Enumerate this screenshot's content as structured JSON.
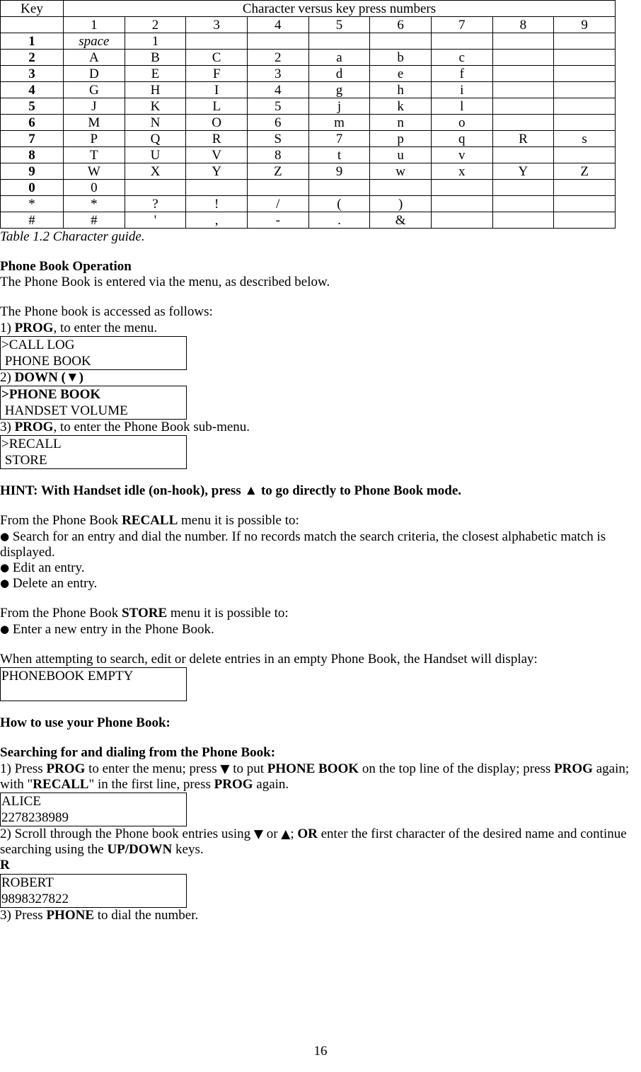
{
  "table": {
    "caption": "Table 1.2 Character guide.",
    "key_header": "Key",
    "span_header": "Character versus key press numbers",
    "press_columns": [
      "1",
      "2",
      "3",
      "4",
      "5",
      "6",
      "7",
      "8",
      "9"
    ],
    "rows": [
      {
        "key": "1",
        "key_bold": true,
        "cells": [
          "space",
          "1",
          "",
          "",
          "",
          "",
          "",
          "",
          ""
        ],
        "italic_first": true
      },
      {
        "key": "2",
        "key_bold": true,
        "cells": [
          "A",
          "B",
          "C",
          "2",
          "a",
          "b",
          "c",
          "",
          ""
        ],
        "italic_first": false
      },
      {
        "key": "3",
        "key_bold": true,
        "cells": [
          "D",
          "E",
          "F",
          "3",
          "d",
          "e",
          "f",
          "",
          ""
        ],
        "italic_first": false
      },
      {
        "key": "4",
        "key_bold": true,
        "cells": [
          "G",
          "H",
          "I",
          "4",
          "g",
          "h",
          "i",
          "",
          ""
        ],
        "italic_first": false
      },
      {
        "key": "5",
        "key_bold": true,
        "cells": [
          "J",
          "K",
          "L",
          "5",
          "j",
          "k",
          "l",
          "",
          ""
        ],
        "italic_first": false
      },
      {
        "key": "6",
        "key_bold": true,
        "cells": [
          "M",
          "N",
          "O",
          "6",
          "m",
          "n",
          "o",
          "",
          ""
        ],
        "italic_first": false
      },
      {
        "key": "7",
        "key_bold": true,
        "cells": [
          "P",
          "Q",
          "R",
          "S",
          "7",
          "p",
          "q",
          "R",
          "s"
        ],
        "italic_first": false
      },
      {
        "key": "8",
        "key_bold": true,
        "cells": [
          "T",
          "U",
          "V",
          "8",
          "t",
          "u",
          "v",
          "",
          ""
        ],
        "italic_first": false
      },
      {
        "key": "9",
        "key_bold": true,
        "cells": [
          "W",
          "X",
          "Y",
          "Z",
          "9",
          "w",
          "x",
          "Y",
          "Z"
        ],
        "italic_first": false
      },
      {
        "key": "0",
        "key_bold": true,
        "cells": [
          "0",
          "",
          "",
          "",
          "",
          "",
          "",
          "",
          ""
        ],
        "italic_first": false
      },
      {
        "key": "*",
        "key_bold": false,
        "cells": [
          "*",
          "?",
          "!",
          "/",
          "(",
          ")",
          "",
          "",
          ""
        ],
        "italic_first": false
      },
      {
        "key": "#",
        "key_bold": false,
        "cells": [
          "#",
          "'",
          ",",
          "-",
          ".",
          "&",
          "",
          "",
          ""
        ],
        "italic_first": false
      }
    ]
  },
  "sections": {
    "phone_book_operation": {
      "heading": "Phone Book Operation",
      "intro": "The Phone Book is entered via the menu, as described below.",
      "accessed_as_follows": "The Phone book is accessed as follows:",
      "step1_prefix": "1) ",
      "step1_bold": "PROG",
      "step1_suffix": ", to enter the menu.",
      "lcd1_line1": ">CALL LOG",
      "lcd1_line2": " PHONE BOOK",
      "step2_prefix": "2)  ",
      "step2_bold": "DOWN (▼)",
      "lcd2_line1": ">PHONE BOOK",
      "lcd2_line2": " HANDSET VOLUME",
      "step3_prefix": "3) ",
      "step3_bold": "PROG",
      "step3_suffix": ", to enter the Phone Book sub-menu.",
      "lcd3_line1": ">RECALL",
      "lcd3_line2": " STORE"
    },
    "hint": "HINT: With Handset idle (on-hook), press ▲ to go directly to Phone Book mode.",
    "recall": {
      "lead_prefix": "From the Phone Book ",
      "lead_bold": "RECALL",
      "lead_suffix": " menu it is possible to:",
      "bullets": [
        "Search for an entry and dial the number. If no records match the search criteria, the closest alphabetic match is displayed.",
        "Edit an entry.",
        "Delete an entry."
      ]
    },
    "store": {
      "lead_prefix": "From the Phone Book ",
      "lead_bold": "STORE",
      "lead_suffix": " menu it is possible to:",
      "bullets": [
        "Enter a new entry in the Phone Book."
      ]
    },
    "empty_book": {
      "text": "When attempting to search, edit or delete entries in an empty Phone Book, the Handset will display:",
      "lcd_line1": "PHONEBOOK EMPTY",
      "lcd_line2": ""
    },
    "how_to_use": {
      "heading": "How to use your Phone Book:",
      "sub_heading": "Searching for and dialing from the Phone Book:",
      "step1_p1": "1) Press ",
      "step1_b1": "PROG",
      "step1_p2": " to enter the menu; press ",
      "step1_b2": "▼",
      "step1_p3": " to put ",
      "step1_b3": "PHONE BOOK",
      "step1_p4": " on the top line of the display; press ",
      "step1_b4": "PROG",
      "step1_p5": " again; with \"",
      "step1_b5": "RECALL",
      "step1_p6": "\" in the first line, press ",
      "step1_b6": "PROG",
      "step1_p7": " again.",
      "lcd_alice_line1": "ALICE",
      "lcd_alice_line2": "2278238989",
      "step2_p1": "2) Scroll through the Phone book entries using ",
      "step2_b1": "▼",
      "step2_p2": " or ",
      "step2_b2": "▲",
      "step2_p3": "; ",
      "step2_b3": "OR",
      "step2_p4": " enter the first character of the desired name and continue searching using the ",
      "step2_b4": "UP/DOWN",
      "step2_p5": " keys.",
      "typed_letter": "R",
      "lcd_robert_line1": "ROBERT",
      "lcd_robert_line2": "9898327822",
      "step3_p1": "3)    Press ",
      "step3_b1": "PHONE",
      "step3_p2": " to dial the number."
    }
  },
  "page_number": "16"
}
